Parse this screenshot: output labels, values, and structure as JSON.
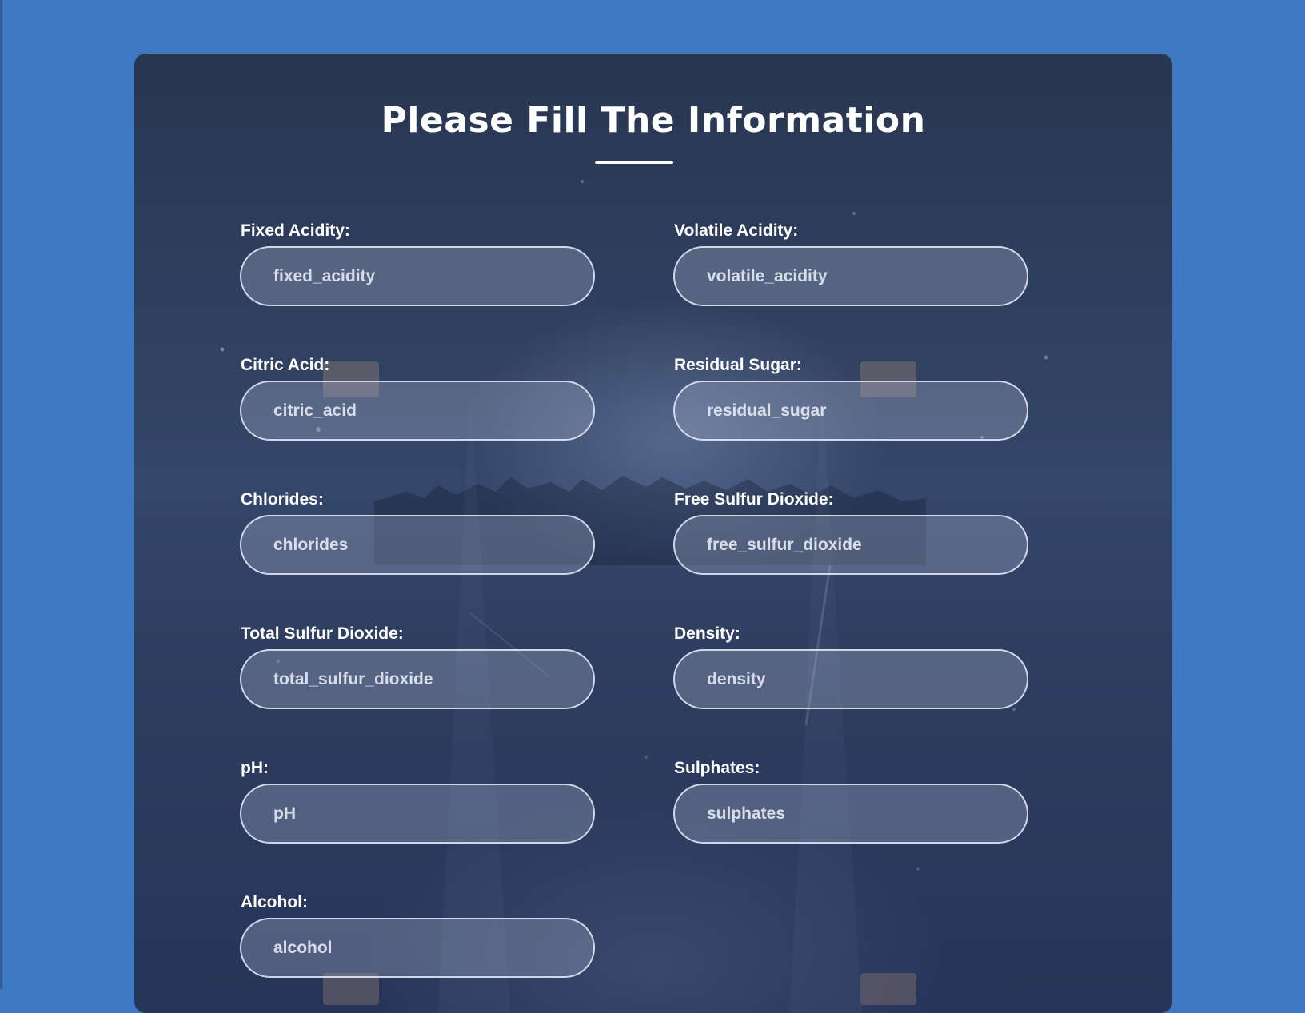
{
  "page": {
    "background_color": "#3f78c2",
    "card_color": "#2c3b5e"
  },
  "form": {
    "title": "Please Fill The Information",
    "fields": [
      {
        "label": "Fixed Acidity:",
        "placeholder": "fixed_acidity"
      },
      {
        "label": "Volatile Acidity:",
        "placeholder": "volatile_acidity"
      },
      {
        "label": "Citric Acid:",
        "placeholder": "citric_acid"
      },
      {
        "label": "Residual Sugar:",
        "placeholder": "residual_sugar"
      },
      {
        "label": "Chlorides:",
        "placeholder": "chlorides"
      },
      {
        "label": "Free Sulfur Dioxide:",
        "placeholder": "free_sulfur_dioxide"
      },
      {
        "label": "Total Sulfur Dioxide:",
        "placeholder": "total_sulfur_dioxide"
      },
      {
        "label": "Density:",
        "placeholder": "density"
      },
      {
        "label": "pH:",
        "placeholder": "pH"
      },
      {
        "label": "Sulphates:",
        "placeholder": "sulphates"
      },
      {
        "label": "Alcohol:",
        "placeholder": "alcohol"
      }
    ]
  }
}
